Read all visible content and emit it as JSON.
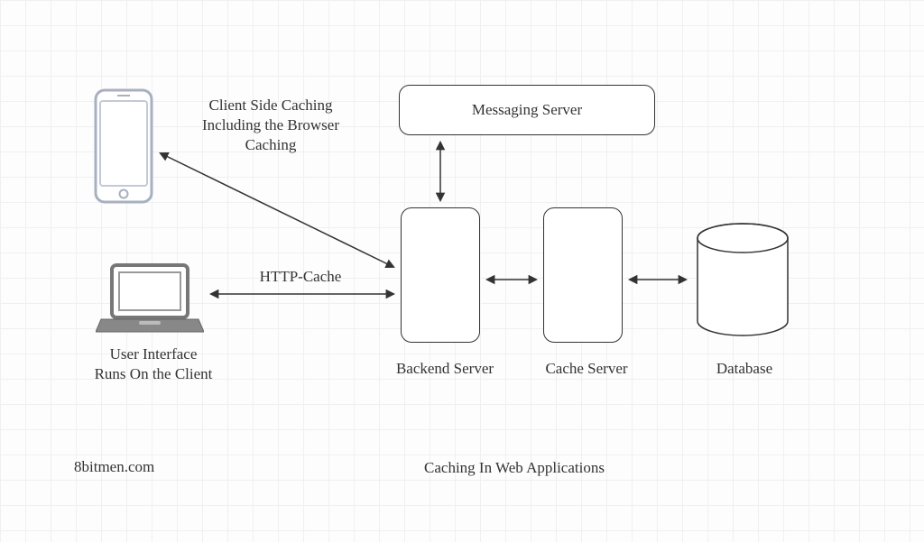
{
  "diagram": {
    "title": "Caching In Web Applications",
    "attribution": "8bitmen.com",
    "nodes": {
      "phone": {
        "name": "phone"
      },
      "laptop": {
        "name": "laptop",
        "caption": "User Interface\nRuns On the Client"
      },
      "messaging": {
        "label": "Messaging Server"
      },
      "backend": {
        "caption": "Backend Server"
      },
      "cache": {
        "caption": "Cache Server"
      },
      "database": {
        "caption": "Database"
      }
    },
    "edges": {
      "client_caching": "Client Side Caching\nIncluding the Browser\nCaching",
      "http_cache": "HTTP-Cache"
    }
  }
}
